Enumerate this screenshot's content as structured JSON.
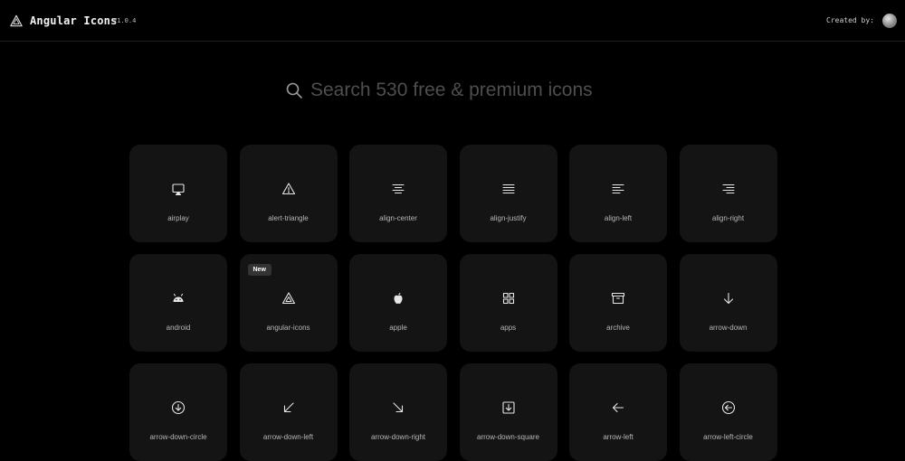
{
  "header": {
    "app_title": "Angular Icons",
    "version": "V1.0.4",
    "created_by": "Created by:"
  },
  "search": {
    "placeholder": "Search 530 free & premium icons",
    "value": ""
  },
  "icons": [
    {
      "label": "airplay",
      "icon": "airplay-icon"
    },
    {
      "label": "alert-triangle",
      "icon": "alert-triangle-icon"
    },
    {
      "label": "align-center",
      "icon": "align-center-icon"
    },
    {
      "label": "align-justify",
      "icon": "align-justify-icon"
    },
    {
      "label": "align-left",
      "icon": "align-left-icon"
    },
    {
      "label": "align-right",
      "icon": "align-right-icon"
    },
    {
      "label": "android",
      "icon": "android-icon"
    },
    {
      "label": "angular-icons",
      "icon": "angular-icons-icon",
      "badge": "New"
    },
    {
      "label": "apple",
      "icon": "apple-icon"
    },
    {
      "label": "apps",
      "icon": "apps-icon"
    },
    {
      "label": "archive",
      "icon": "archive-icon"
    },
    {
      "label": "arrow-down",
      "icon": "arrow-down-icon"
    },
    {
      "label": "arrow-down-circle",
      "icon": "arrow-down-circle-icon"
    },
    {
      "label": "arrow-down-left",
      "icon": "arrow-down-left-icon"
    },
    {
      "label": "arrow-down-right",
      "icon": "arrow-down-right-icon"
    },
    {
      "label": "arrow-down-square",
      "icon": "arrow-down-square-icon"
    },
    {
      "label": "arrow-left",
      "icon": "arrow-left-icon"
    },
    {
      "label": "arrow-left-circle",
      "icon": "arrow-left-circle-icon"
    }
  ]
}
